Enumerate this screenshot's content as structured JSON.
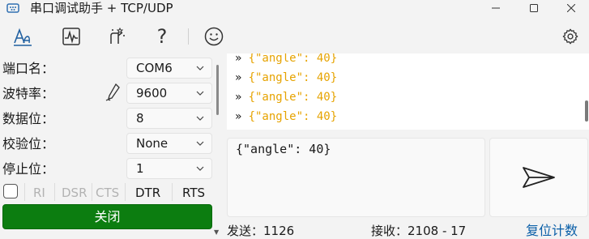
{
  "window": {
    "title": "串口调试助手 + TCP/UDP",
    "icons": {
      "app": "serial-port-icon",
      "minimize": "minimize-icon",
      "maximize": "maximize-icon",
      "close": "close-icon"
    }
  },
  "toolbar": {
    "icons": [
      "font-icon",
      "waveform-icon",
      "magic-wand-icon",
      "help-icon",
      "smiley-icon",
      "gear-icon"
    ],
    "help_glyph": "?"
  },
  "settings": {
    "port": {
      "label": "端口名：",
      "value": "COM6"
    },
    "baud": {
      "label": "波特率：",
      "value": "9600"
    },
    "data_bits": {
      "label": "数据位：",
      "value": "8"
    },
    "parity": {
      "label": "校验位：",
      "value": "None"
    },
    "stop_bits": {
      "label": "停止位：",
      "value": "1"
    }
  },
  "signals": {
    "checkbox_checked": false,
    "ri": "RI",
    "dsr": "DSR",
    "cts": "CTS",
    "dtr": "DTR",
    "rts": "RTS"
  },
  "close_button": {
    "label": "关闭",
    "color": "#0c7d10"
  },
  "log": {
    "arrow": "»",
    "lines": [
      "{\"angle\": 40}",
      "{\"angle\": 40}",
      "{\"angle\": 40}",
      "{\"angle\": 40}"
    ],
    "text_color": "#e6a300"
  },
  "input": {
    "value": "{\"angle\": 40}"
  },
  "send_button": {
    "icon": "send-icon"
  },
  "status": {
    "sent": "发送：1126",
    "received": "接收：2108 - 17",
    "reset_label": "复位计数"
  }
}
